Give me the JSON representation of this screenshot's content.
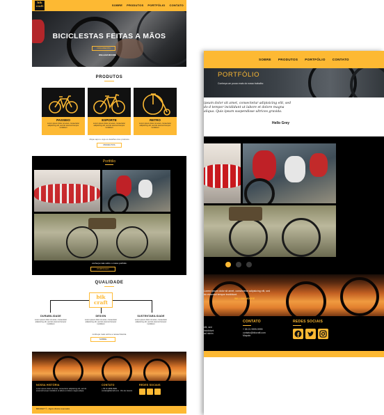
{
  "left": {
    "nav": {
      "logo": "bik craft",
      "items": [
        "SOBRE",
        "PRODUTOS",
        "PORTFÓLIO",
        "CONTATO"
      ]
    },
    "hero": {
      "title": "BICICLESTAS FEITAS A MÃOS",
      "button": "ORÇAMENTO",
      "author": "WILLIAM MOORE"
    },
    "products": {
      "title": "PRODUTOS",
      "items": [
        {
          "name": "PASSEIO",
          "desc": "Lorem ipsum dolor sit amet, consectetur adipisicing elit, sed do eiusmod tempor incididunt"
        },
        {
          "name": "ESPORTE",
          "desc": "Lorem ipsum dolor sit amet, consectetur adipisicing elit, sed do eiusmod tempor incididunt"
        },
        {
          "name": "RETRO",
          "desc": "Lorem ipsum dolor sit amet, consectetur adipisicing elit, sed do eiusmod tempor incididunt"
        }
      ],
      "note": "clique aqui e veja os detalhes dos produtos",
      "button": "PRODUTOS"
    },
    "portfolio": {
      "title": "Portfólio",
      "note": "conheça mais sobre o nosso portfolio",
      "button": "PORTFOLIO"
    },
    "quality": {
      "title": "QUALIDADE",
      "logo": "bik craft",
      "items": [
        {
          "name": "DURABILIDADE",
          "desc": "Lorem ipsum dolor sit amet, consectetur adipisicing elit, sed do eiusmod tempor incididunt"
        },
        {
          "name": "DESIGN",
          "desc": "Lorem ipsum dolor sit amet, consectetur adipisicing elit, sed do eiusmod tempor incididunt"
        },
        {
          "name": "SUSTENTABILIDADE",
          "desc": "Lorem ipsum dolor sit amet, consectetur adipisicing elit, sed do eiusmod tempor incididunt"
        }
      ],
      "note": "conheça mais sobre a nossa história",
      "button": "SOBRE"
    },
    "footer": {
      "history_title": "NOSSA HISTÓRIA",
      "history_text": "Lorem ipsum dolor sit amet, consectetur adipisicing elit, sed do eiusmod tempor incididunt ut labore et dolore magna aliqua.",
      "contact_title": "CONTATO",
      "contact_text": "+ 55 21 9999-9999 · contato@bikcraft.com · Rio de Janeiro",
      "social_title": "REDES SOCIAIS",
      "copyright": "BIKCRAFT © - Alguns direitos reservados"
    }
  },
  "right": {
    "nav": {
      "items": [
        "SOBRE",
        "PRODUTOS",
        "PORTFÓLIO",
        "CONTATO"
      ]
    },
    "banner": {
      "title": "PORTFÓLIO",
      "subtitle": "Conheça um pouco mais do nosso trabalho"
    },
    "quote": {
      "text": "ipsum dolor sit amet, consectetur adipisicing elit, sed do d tempor incididunt ut labore et dolore magna aliqua. Quis ipsum suspendisse ultrices gravida.",
      "author": "Hello Grey"
    },
    "sunset": {
      "quote": "Lorem ipsum dolor sit amet, consectetur adipisicing elit, sed do eiusmod tempor incididunt.",
      "author": "WILLIAM MOORE"
    },
    "footer": {
      "contact_title": "CONTATO",
      "contact_lines": [
        "+ 55 21 9999-9999",
        "contato@bikcraft.com",
        "Maputo"
      ],
      "left_lines": [
        "elit, sed",
        "incididunt",
        "ad minim"
      ],
      "social_title": "REDES SOCIAIS"
    }
  },
  "colors": {
    "accent": "#fdb933",
    "dark": "#000000"
  }
}
